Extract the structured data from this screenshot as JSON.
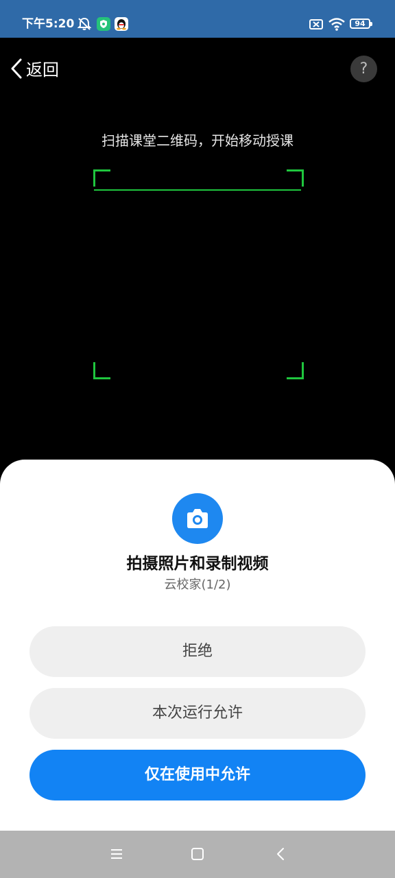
{
  "status_bar": {
    "time": "下午5:20",
    "battery": "94",
    "icons": [
      "mute-alarm-icon",
      "security-shield-icon",
      "qq-penguin-icon",
      "no-sim-icon",
      "wifi-icon",
      "battery-icon"
    ]
  },
  "header": {
    "back_label": "返回",
    "help_symbol": "?"
  },
  "scanner": {
    "hint": "扫描课堂二维码，开始移动授课",
    "frame_color": "#1fc63e"
  },
  "permission_dialog": {
    "title": "拍摄照片和录制视频",
    "subtitle": "云校家(1/2)",
    "deny_label": "拒绝",
    "allow_once_label": "本次运行允许",
    "allow_while_using_label": "仅在使用中允许",
    "accent_color": "#1283f4"
  },
  "nav_bar": {
    "icons": [
      "menu-icon",
      "home-icon",
      "back-icon"
    ]
  }
}
